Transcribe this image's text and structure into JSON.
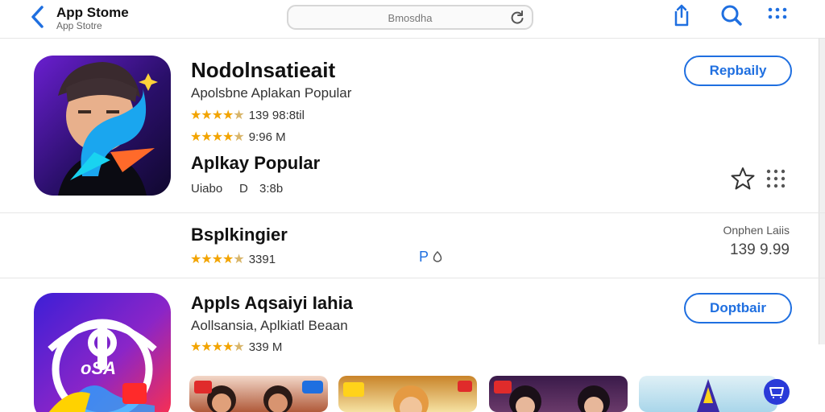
{
  "header": {
    "title": "App Stome",
    "subtitle": "App Stotre",
    "search_text": "Bmosdha"
  },
  "row1": {
    "name": "Nodolnsatieait",
    "subtitle": "Apolsbne Aplakan Popular",
    "rating_text": "139 98:8til",
    "rating2_text": "9:96 M",
    "section": "Aplkay Popular",
    "meta_left": "Uiabo",
    "meta_mid": "D",
    "meta_right": "3:8b",
    "button": "Repbaily"
  },
  "row2": {
    "name": "Bsplkingier",
    "rating_text": "3391",
    "mid_label": "P",
    "right_label": "Onphen Laiis",
    "price": "139 9.99"
  },
  "row3": {
    "name": "Appls Aqsaiyi Iahia",
    "subtitle": "Aollsansia, Aplkiatl Beaan",
    "rating_text": "339 M",
    "button": "Doptbair",
    "icon_label": "oSA"
  },
  "colors": {
    "accent": "#1f6fe0",
    "star": "#f2a400"
  }
}
